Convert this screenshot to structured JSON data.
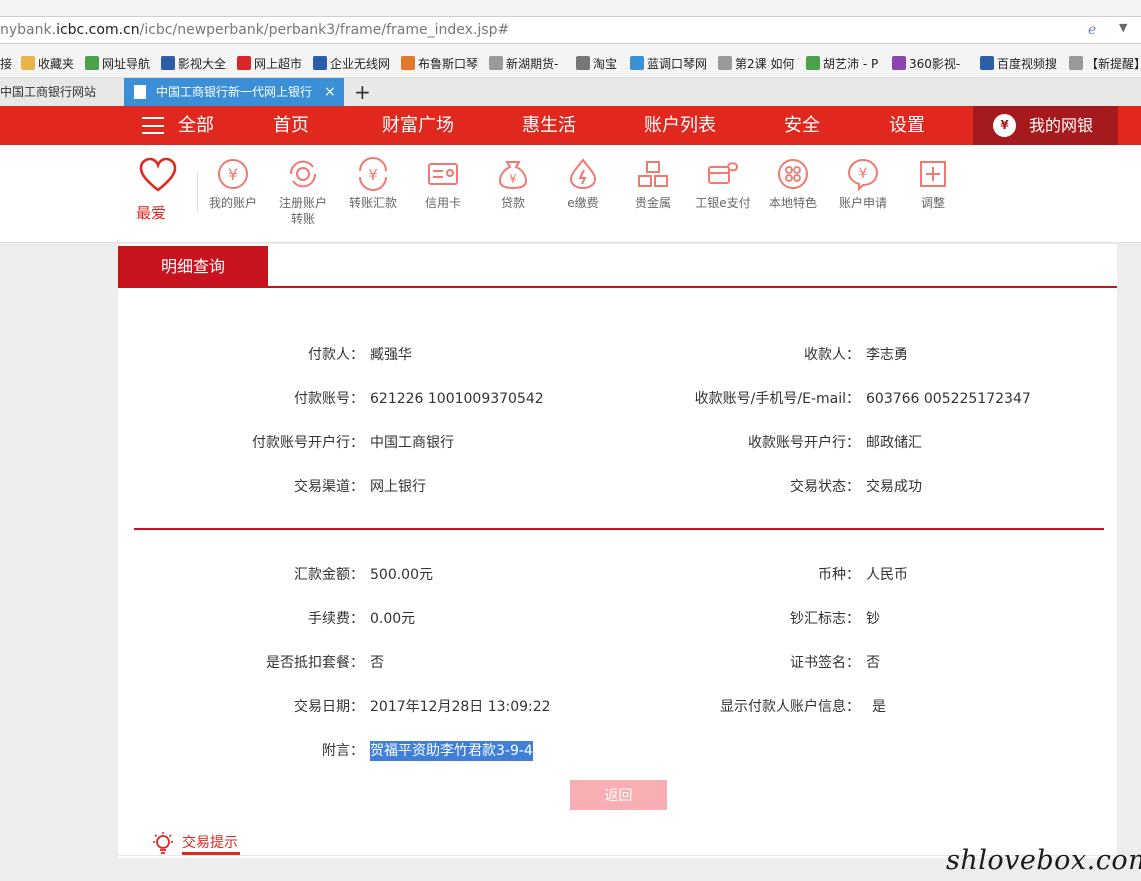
{
  "browser": {
    "url_prefix": "nybank.",
    "url_domain": "icbc.com.cn",
    "url_path": "/icbc/newperbank/perbank3/frame/frame_index.jsp#",
    "bookmarks": [
      {
        "label": "接",
        "icon": "bookmark-icon",
        "color": "#999999"
      },
      {
        "label": "收藏夹",
        "icon": "folder-icon",
        "color": "#e9b44c"
      },
      {
        "label": "网址导航",
        "icon": "nav-icon",
        "color": "#4aa34a"
      },
      {
        "label": "影视大全",
        "icon": "video-icon",
        "color": "#2d5fa8"
      },
      {
        "label": "网上超市",
        "icon": "market-icon",
        "color": "#d8262b"
      },
      {
        "label": "企业无线网",
        "icon": "paw-icon",
        "color": "#2d5fa8"
      },
      {
        "label": "布鲁斯口琴",
        "icon": "music-icon",
        "color": "#e0782c"
      },
      {
        "label": "新湖期货-",
        "icon": "page-icon",
        "color": "#999999"
      },
      {
        "label": "淘宝",
        "icon": "taobao-icon",
        "color": "#777777"
      },
      {
        "label": "蓝调口琴网",
        "icon": "windows-icon",
        "color": "#3d8fd6"
      },
      {
        "label": "第2课 如何",
        "icon": "page-icon",
        "color": "#999999"
      },
      {
        "label": "胡艺沛 - P",
        "icon": "tile-icon",
        "color": "#4aa34a"
      },
      {
        "label": "360影视-",
        "icon": "play-icon",
        "color": "#8e44ad"
      },
      {
        "label": "百度视频搜",
        "icon": "paw-icon",
        "color": "#2d5fa8"
      },
      {
        "label": "【新提醒】",
        "icon": "page-icon",
        "color": "#999999"
      }
    ],
    "tabs": {
      "inactive_label": "中国工商银行网站",
      "active_label": "中国工商银行新一代网上银行",
      "close": "×",
      "new_tab": "+"
    }
  },
  "nav": {
    "all_label": "全部",
    "items": [
      "首页",
      "财富广场",
      "惠生活",
      "账户列表",
      "安全",
      "设置"
    ],
    "mybank_label": "我的网银",
    "accent": "#e1281f"
  },
  "funcbar": {
    "favorite_label": "最爱",
    "items": [
      {
        "label": "我的账户",
        "icon": "yen-circle-icon"
      },
      {
        "label": "注册账户",
        "label2": "转账",
        "icon": "refresh-yen-icon"
      },
      {
        "label": "转账汇款",
        "icon": "transfer-yen-icon"
      },
      {
        "label": "信用卡",
        "icon": "credit-card-icon"
      },
      {
        "label": "贷款",
        "icon": "money-bag-icon"
      },
      {
        "label": "e缴费",
        "icon": "flame-icon"
      },
      {
        "label": "贵金属",
        "icon": "gold-bars-icon"
      },
      {
        "label": "工银e支付",
        "icon": "e-pay-icon"
      },
      {
        "label": "本地特色",
        "icon": "dots-circle-icon"
      },
      {
        "label": "账户申请",
        "icon": "yen-bubble-icon"
      },
      {
        "label": "调整",
        "icon": "plus-square-icon"
      }
    ]
  },
  "detail": {
    "tab_label": "明细查询",
    "payer_label": "付款人：",
    "payer": "臧强华",
    "payee_label": "收款人：",
    "payee": "李志勇",
    "payer_account_label": "付款账号：",
    "payer_account": "621226 1001009370542",
    "payee_account_label": "收款账号/手机号/E-mail：",
    "payee_account": "603766 005225172347",
    "payer_bank_label": "付款账号开户行：",
    "payer_bank": "中国工商银行",
    "payee_bank_label": "收款账号开户行：",
    "payee_bank": "邮政储汇",
    "channel_label": "交易渠道：",
    "channel": "网上银行",
    "status_label": "交易状态：",
    "status": "交易成功",
    "amount_label": "汇款金额：",
    "amount": "500.00元",
    "currency_label": "币种：",
    "currency": "人民币",
    "fee_label": "手续费：",
    "fee": "0.00元",
    "cash_label": "钞汇标志：",
    "cash": "钞",
    "package_label": "是否抵扣套餐：",
    "package": "否",
    "cert_label": "证书签名：",
    "cert": "否",
    "date_label": "交易日期：",
    "date": "2017年12月28日 13:09:22",
    "show_info_label": "显示付款人账户信息：",
    "show_info": "是",
    "note_label": "附言：",
    "note": "贺福平资助李竹君款3-9-4",
    "back_label": "返回"
  },
  "tips": {
    "label": "交易提示"
  },
  "watermark": "shlovebox.com"
}
